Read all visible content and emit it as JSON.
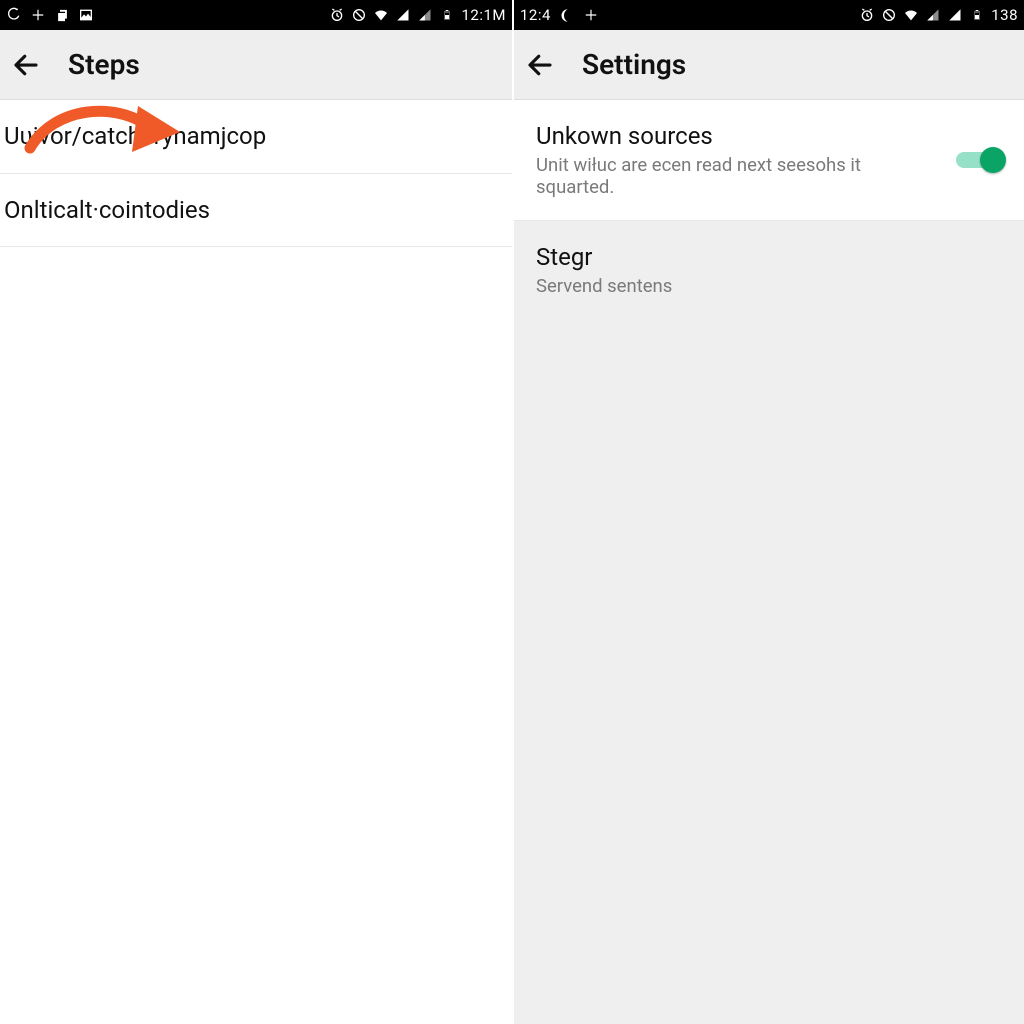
{
  "left": {
    "status": {
      "time": "12:1M"
    },
    "header": {
      "title": "Steps"
    },
    "rows": [
      {
        "title": "Uʋivor/catcherynamjcop"
      },
      {
        "title": "Onlticalt·cointodies"
      }
    ]
  },
  "right": {
    "status": {
      "time_left": "12:4",
      "time_right": "138"
    },
    "header": {
      "title": "Settings"
    },
    "rows": [
      {
        "title": "Unkown sources",
        "sub": "Unit wiłuc are ecen read next seesohs it squarted.",
        "toggle_on": true
      },
      {
        "title": "Stegr",
        "sub": "Servend sentens"
      }
    ]
  },
  "colors": {
    "accent": "#0aa566",
    "arrow": "#f05a28"
  }
}
